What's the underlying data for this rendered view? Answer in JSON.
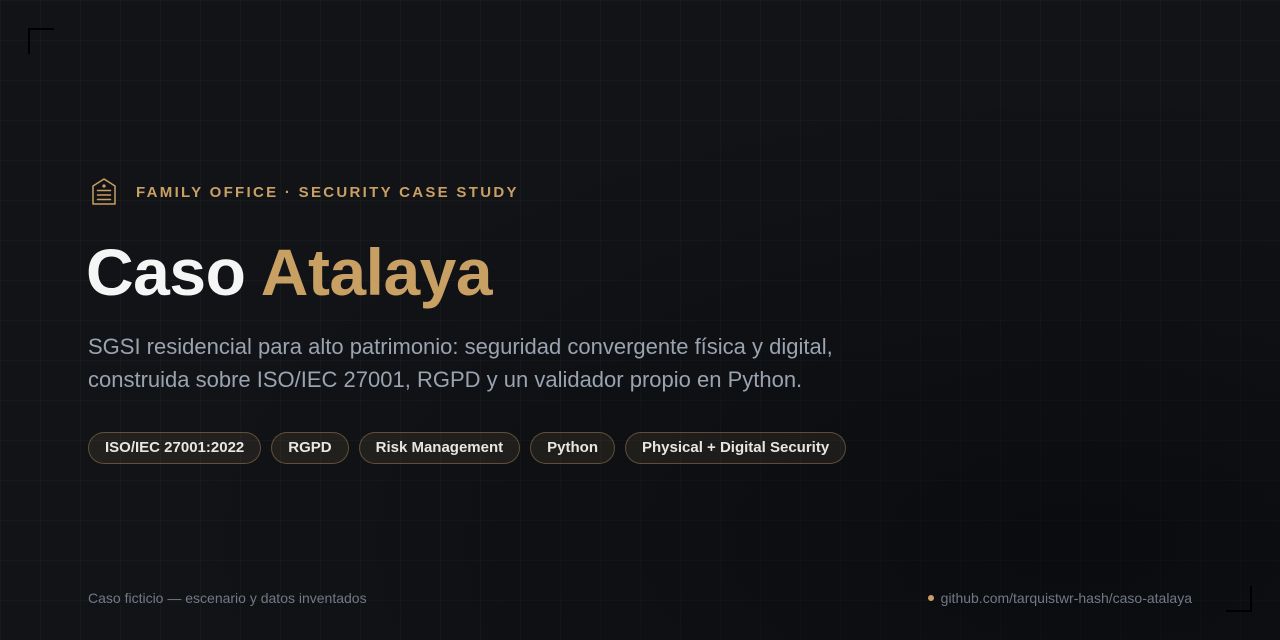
{
  "eyebrow": {
    "icon": "shield-icon",
    "text": "FAMILY OFFICE · SECURITY CASE STUDY"
  },
  "title": {
    "main": "Caso",
    "accent": "Atalaya"
  },
  "subtitle": {
    "line1": "SGSI residencial para alto patrimonio: seguridad convergente física y digital,",
    "line2": "construida sobre ISO/IEC 27001, RGPD y un validador propio en Python."
  },
  "tags": [
    "ISO/IEC 27001:2022",
    "RGPD",
    "Risk Management",
    "Python",
    "Physical + Digital Security"
  ],
  "footer": {
    "note": "Caso ficticio — escenario y datos inventados",
    "link": "github.com/tarquistwr-hash/caso-atalaya"
  },
  "colors": {
    "background": "#111317",
    "accent": "#c9a063",
    "title": "#f5f5f5",
    "subtitle": "#9aa3b0",
    "muted": "#727986"
  }
}
